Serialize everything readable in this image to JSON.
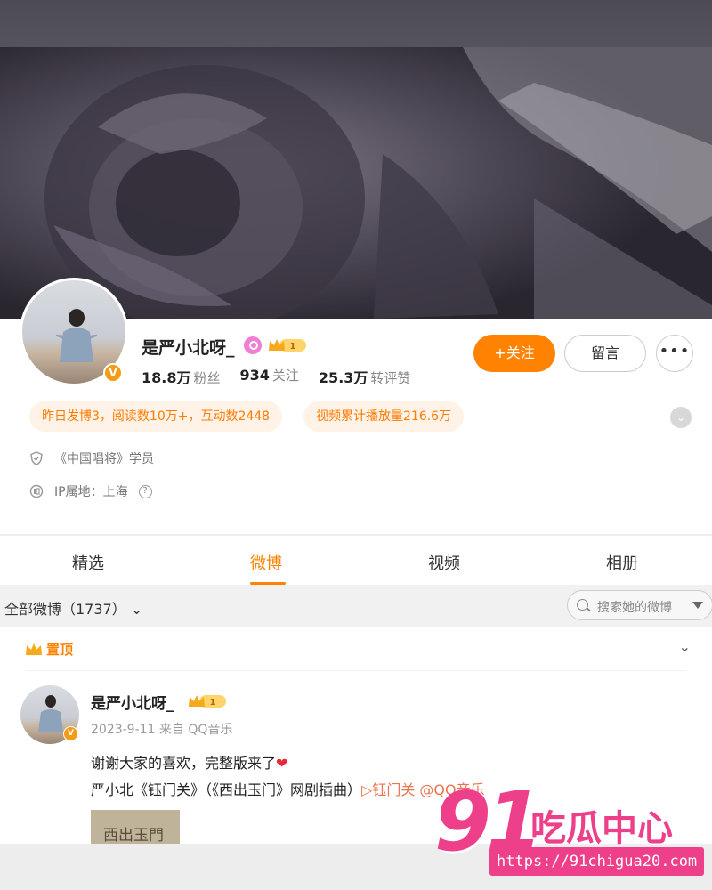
{
  "profile": {
    "nickname": "是严小北呀_",
    "vip_level": "1",
    "stats": [
      {
        "value": "18.8万",
        "label": "粉丝"
      },
      {
        "value": "934",
        "label": "关注"
      },
      {
        "value": "25.3万",
        "label": "转评赞"
      }
    ],
    "follow_label": "+关注",
    "message_label": "留言",
    "more_label": "•••",
    "highlights": [
      "昨日发博3，阅读数10万+，互动数2448",
      "视频累计播放量216.6万"
    ],
    "info": {
      "tag": "《中国唱将》学员",
      "ip": "IP属地：上海"
    },
    "verified_badge": "V"
  },
  "tabs": [
    {
      "label": "精选",
      "active": false
    },
    {
      "label": "微博",
      "active": true
    },
    {
      "label": "视频",
      "active": false
    },
    {
      "label": "相册",
      "active": false
    }
  ],
  "filter": {
    "label": "全部微博（1737）",
    "search_placeholder": "搜索她的微博"
  },
  "post": {
    "pin_label": "置顶",
    "author": "是严小北呀_",
    "vip_level": "1",
    "meta": "2023-9-11 来自 QQ音乐",
    "text_line1": "谢谢大家的喜欢，完整版来了",
    "heart": "❤",
    "text_line2": "严小北《钰门关》（《西出玉门》网剧插曲）",
    "link_text": "▷钰门关 @QQ音乐",
    "thumb_text": "西出玉門"
  },
  "watermark": {
    "number": "91",
    "name": "吃瓜中心",
    "url": "https://91chigua20.com"
  },
  "colors": {
    "accent": "#ff8200",
    "pill_bg": "#fff2e6",
    "watermark": "#ee3f8a"
  }
}
